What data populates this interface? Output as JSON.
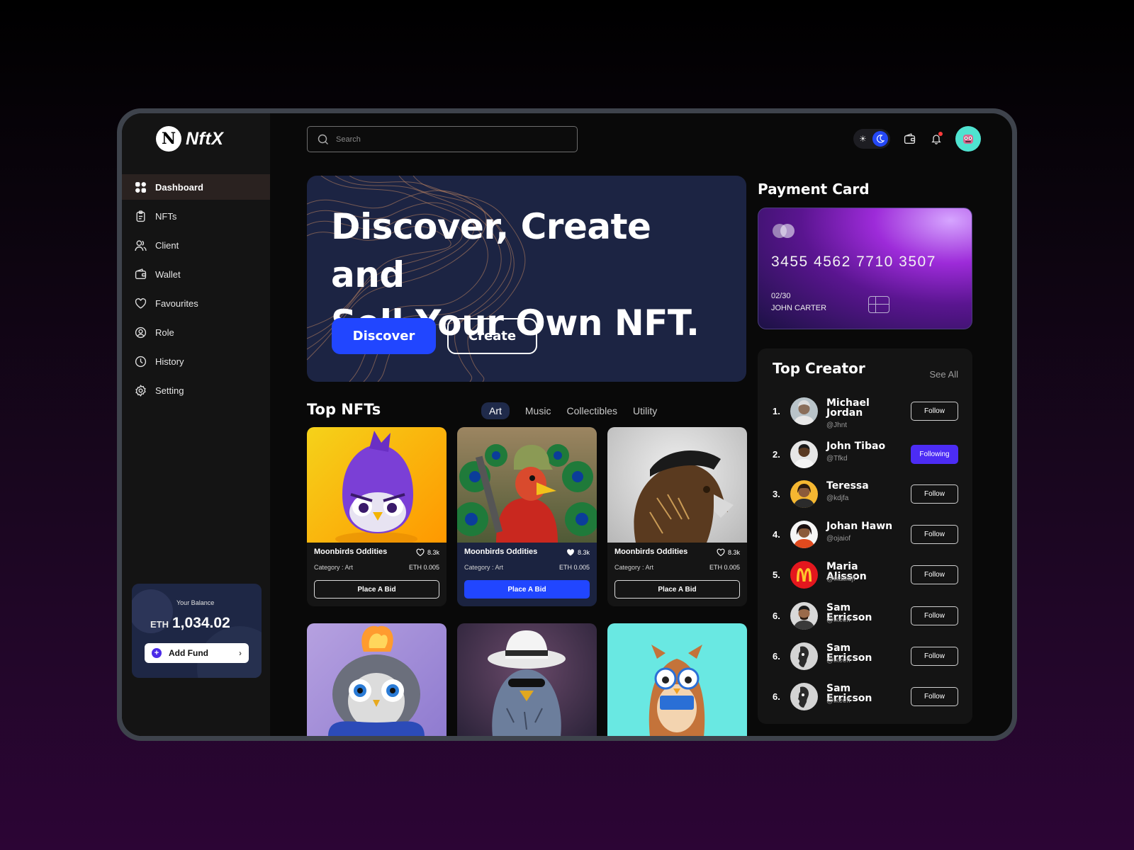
{
  "brand": {
    "logo_letter": "N",
    "name": "NftX"
  },
  "sidebar": {
    "items": [
      {
        "label": "Dashboard",
        "icon": "grid-icon",
        "active": true
      },
      {
        "label": "NFTs",
        "icon": "clipboard-icon"
      },
      {
        "label": "Client",
        "icon": "users-icon"
      },
      {
        "label": "Wallet",
        "icon": "wallet-icon"
      },
      {
        "label": "Favourites",
        "icon": "heart-icon"
      },
      {
        "label": "Role",
        "icon": "user-circle-icon"
      },
      {
        "label": "History",
        "icon": "clock-icon"
      },
      {
        "label": "Setting",
        "icon": "gear-icon"
      }
    ],
    "balance": {
      "label": "Your Balance",
      "currency": "ETH",
      "amount": "1,034.02",
      "add_fund_label": "Add Fund"
    }
  },
  "header": {
    "search_placeholder": "Search",
    "theme": "dark",
    "sun_glyph": "☀"
  },
  "hero": {
    "title_line1": "Discover, Create and",
    "title_line2": "Sell Your Own NFT.",
    "discover_label": "Discover",
    "create_label": "Create"
  },
  "top_nfts": {
    "title": "Top NFTs",
    "filters": [
      "Art",
      "Music",
      "Collectibles",
      "Utility"
    ],
    "active_filter": "Art",
    "cards": [
      {
        "name": "Moonbirds Oddities",
        "likes": "8.3k",
        "category": "Category : Art",
        "price": "ETH 0.005",
        "bid_label": "Place A Bid"
      },
      {
        "name": "Moonbirds Oddities",
        "likes": "8.3k",
        "category": "Category : Art",
        "price": "ETH 0.005",
        "bid_label": "Place A Bid"
      },
      {
        "name": "Moonbirds Oddities",
        "likes": "8.3k",
        "category": "Category : Art",
        "price": "ETH 0.005",
        "bid_label": "Place A Bid"
      }
    ]
  },
  "payment": {
    "title": "Payment Card",
    "card_number": "3455 4562 7710 3507",
    "expiry": "02/30",
    "holder": "JOHN CARTER"
  },
  "top_creator": {
    "title": "Top Creator",
    "see_all": "See All",
    "creators": [
      {
        "rank": "1.",
        "name": "Michael Jordan",
        "handle": "@Jhnt",
        "button": "Follow",
        "following": false
      },
      {
        "rank": "2.",
        "name": "John Tibao",
        "handle": "@Tfkd",
        "button": "Following",
        "following": true
      },
      {
        "rank": "3.",
        "name": "Teressa",
        "handle": "@kdjfa",
        "button": "Follow",
        "following": false
      },
      {
        "rank": "4.",
        "name": "Johan Hawn",
        "handle": "@ojaiof",
        "button": "Follow",
        "following": false
      },
      {
        "rank": "5.",
        "name": "Maria Alisson",
        "handle": "@ikasidjf",
        "button": "Follow",
        "following": false
      },
      {
        "rank": "6.",
        "name": "Sam Erricson",
        "handle": "@ikeeff",
        "button": "Follow",
        "following": false
      },
      {
        "rank": "6.",
        "name": "Sam Erricson",
        "handle": "@ikeeff",
        "button": "Follow",
        "following": false
      },
      {
        "rank": "6.",
        "name": "Sam Erricson",
        "handle": "@ikeeff",
        "button": "Follow",
        "following": false
      }
    ]
  },
  "colors": {
    "accent": "#2146ff",
    "following": "#4c2cf5",
    "hero_bg": "#1c2443"
  }
}
